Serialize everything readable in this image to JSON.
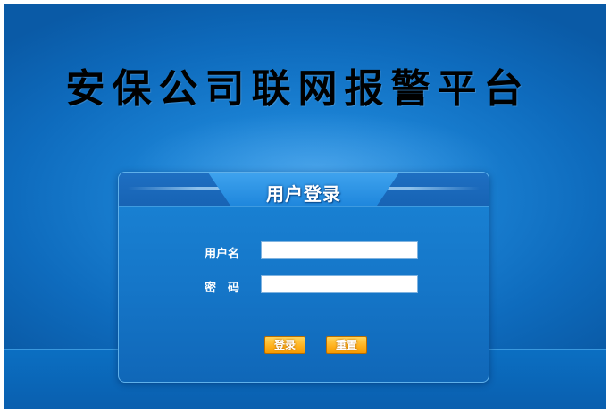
{
  "page": {
    "title": "安保公司联网报警平台"
  },
  "login": {
    "title": "用户登录",
    "username_label": "用户名",
    "username_value": "",
    "password_label": "密　码",
    "password_value": "",
    "login_button": "登录",
    "reset_button": "重置"
  },
  "colors": {
    "background": "#1b82d4",
    "panel": "#1576c8",
    "button": "#ffb21f"
  }
}
